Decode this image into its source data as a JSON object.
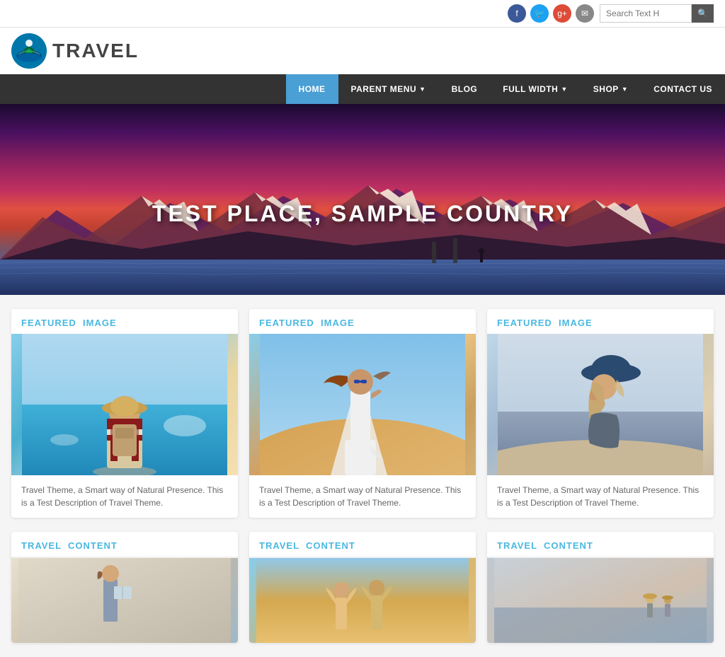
{
  "site": {
    "logo_text": "TRAVEL",
    "logo_icon": "🌴"
  },
  "top_bar": {
    "search_placeholder": "Search Text H",
    "search_button": "🔍",
    "social": [
      {
        "name": "facebook",
        "label": "f",
        "class": "si-fb"
      },
      {
        "name": "twitter",
        "label": "t",
        "class": "si-tw"
      },
      {
        "name": "google-plus",
        "label": "g+",
        "class": "si-gp"
      },
      {
        "name": "email",
        "label": "✉",
        "class": "si-em"
      }
    ]
  },
  "nav": {
    "items": [
      {
        "label": "HOME",
        "active": true,
        "has_arrow": false
      },
      {
        "label": "PARENT MENU",
        "active": false,
        "has_arrow": true
      },
      {
        "label": "BLOG",
        "active": false,
        "has_arrow": false
      },
      {
        "label": "FULL WIDTH",
        "active": false,
        "has_arrow": true
      },
      {
        "label": "SHOP",
        "active": false,
        "has_arrow": true
      },
      {
        "label": "CONTACT US",
        "active": false,
        "has_arrow": false
      }
    ]
  },
  "hero": {
    "title": "TEST PLACE, SAMPLE COUNTRY"
  },
  "featured_cards": [
    {
      "heading_prefix": "FEATURED",
      "heading_accent": "IMAGE",
      "description": "Travel Theme, a Smart way of Natural Presence. This is a Test Description of Travel Theme."
    },
    {
      "heading_prefix": "FEATURED",
      "heading_accent": "IMAGE",
      "description": "Travel Theme, a Smart way of Natural Presence. This is a Test Description of Travel Theme."
    },
    {
      "heading_prefix": "FEATURED",
      "heading_accent": "IMAGE",
      "description": "Travel Theme, a Smart way of Natural Presence. This is a Test Description of Travel Theme."
    }
  ],
  "travel_content_cards": [
    {
      "heading_prefix": "TRAVEL",
      "heading_accent": "CONTENT"
    },
    {
      "heading_prefix": "TRAVEL",
      "heading_accent": "CONTENT"
    },
    {
      "heading_prefix": "TRAVEL",
      "heading_accent": "CONTENT"
    }
  ]
}
